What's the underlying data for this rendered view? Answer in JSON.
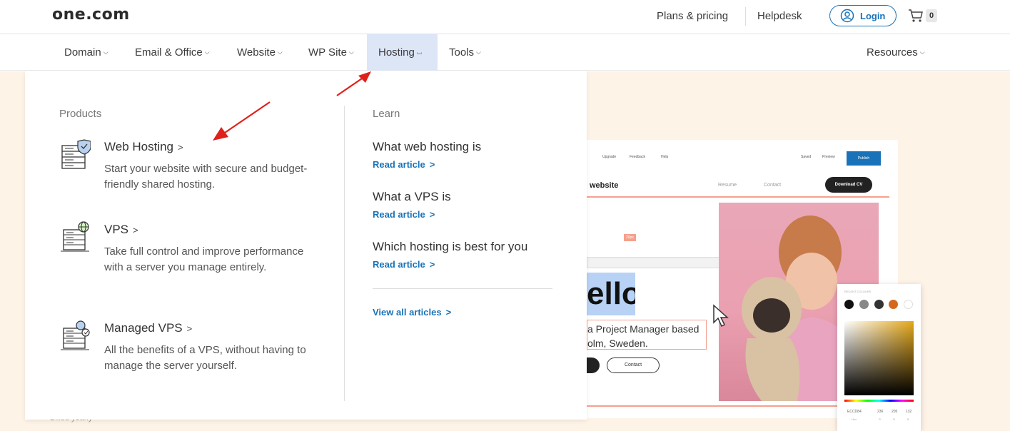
{
  "header": {
    "logo": "one.com",
    "links": [
      "Plans & pricing",
      "Helpdesk"
    ],
    "login_label": "Login",
    "cart_count": "0"
  },
  "nav": {
    "items": [
      "Domain",
      "Email & Office",
      "Website",
      "WP Site",
      "Hosting",
      "Tools"
    ],
    "active": "Hosting",
    "right_item": "Resources"
  },
  "dropdown": {
    "products_heading": "Products",
    "products": [
      {
        "title": "Web Hosting",
        "desc": "Start your website with secure and budget-friendly shared hosting.",
        "icon": "web-hosting-server-shield-icon"
      },
      {
        "title": "VPS",
        "desc": "Take full control and improve performance with a server you manage entirely.",
        "icon": "vps-server-globe-icon"
      },
      {
        "title": "Managed VPS",
        "desc": "All the benefits of a VPS, without having to manage the server yourself.",
        "icon": "managed-vps-server-icon"
      }
    ],
    "learn_heading": "Learn",
    "articles": [
      {
        "title": "What web hosting is",
        "link": "Read article"
      },
      {
        "title": "What a VPS is",
        "link": "Read article"
      },
      {
        "title": "Which hosting is best for you",
        "link": "Read article"
      }
    ],
    "view_all": "View all articles"
  },
  "background": {
    "billed_text": "Billed yearly"
  },
  "mock": {
    "toolbar_items": [
      "Upgrade",
      "Feedback",
      "Help",
      "Saved",
      "Preview",
      "Publish"
    ],
    "site_title": "website",
    "site_nav": [
      "Resume",
      "Contact"
    ],
    "download_cv": "Download CV",
    "hello": "ello",
    "pm_line1": "a Project Manager based",
    "pm_line2": "olm, Sweden.",
    "contact_btn": "Contact",
    "px_badge": "20px",
    "recent_colours": "RECENT COLOURS",
    "hex": "ECCD84",
    "rgb": [
      "236",
      "205",
      "132"
    ],
    "value_labels": [
      "Hex",
      "R",
      "G",
      "B"
    ]
  },
  "colors": {
    "accent": "#1a73b8",
    "active_nav_bg": "#dce6f7",
    "peach_bg": "#fef3e7",
    "arrow": "#e0201a"
  }
}
